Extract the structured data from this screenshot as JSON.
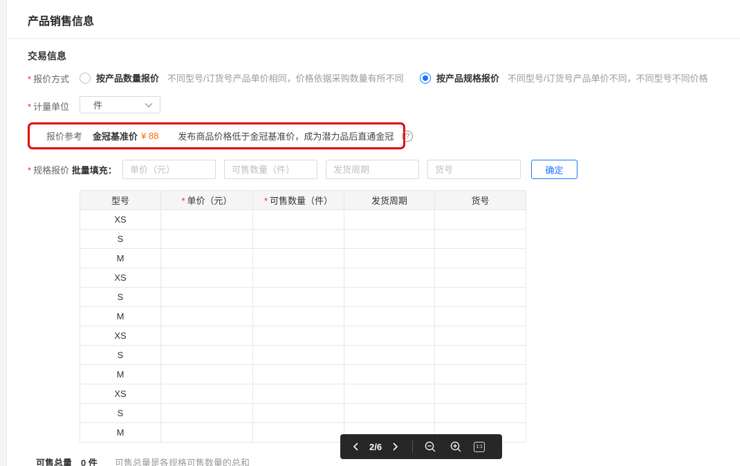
{
  "page": {
    "title": "产品销售信息"
  },
  "section": {
    "title": "交易信息"
  },
  "required_marker": "*",
  "quote_method": {
    "label": "报价方式",
    "options": [
      {
        "label": "按产品数量报价",
        "desc": "不同型号/订货号产品单价相同，价格依据采购数量有所不同",
        "selected": false
      },
      {
        "label": "按产品规格报价",
        "desc": "不同型号/订货号产品单价不同，不同型号不同价格",
        "selected": true
      }
    ]
  },
  "unit": {
    "label": "计量单位",
    "value": "件"
  },
  "reference": {
    "label": "报价参考",
    "benchmark_label": "金冠基准价",
    "benchmark_price": "¥ 88",
    "desc": "发布商品价格低于金冠基准价，成为潜力品后直通金冠",
    "help_icon_glyph": "?"
  },
  "spec_quote": {
    "label": "规格报价",
    "batch_label": "批量填充：",
    "placeholders": {
      "price": "单价（元）",
      "quantity": "可售数量（件）",
      "cycle": "发货周期",
      "item_no": "货号"
    },
    "confirm_label": "确定"
  },
  "table": {
    "headers": [
      {
        "label": "型号",
        "required": false
      },
      {
        "label": "单价（元）",
        "required": true
      },
      {
        "label": "可售数量（件）",
        "required": true
      },
      {
        "label": "发货周期",
        "required": false
      },
      {
        "label": "货号",
        "required": false
      }
    ],
    "rows": [
      "XS",
      "S",
      "M",
      "XS",
      "S",
      "M",
      "XS",
      "S",
      "M",
      "XS",
      "S",
      "M"
    ]
  },
  "pager": {
    "page_indicator": "2/6",
    "ratio_label": "1:1"
  },
  "total": {
    "label": "可售总量",
    "value": "0 件",
    "hint": "可售总量是各规格可售数量的总和"
  },
  "colors": {
    "accent_blue": "#1677ff",
    "highlight_red": "#e60000",
    "price_orange": "#ff6600",
    "required_red": "#f5222d",
    "table_header_bg": "#f5f5f6",
    "toolbar_bg": "#101010"
  }
}
